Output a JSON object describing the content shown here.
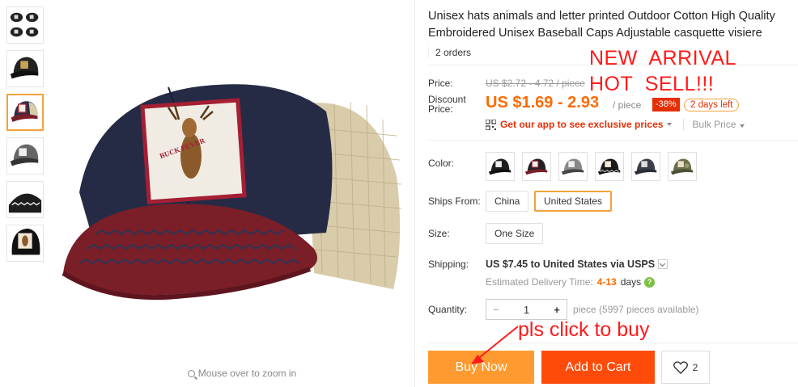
{
  "product": {
    "title": "Unisex hats animals and letter printed Outdoor Cotton High Quality Embroidered Unisex Baseball Caps Adjustable casquette visiere",
    "orders": "2 orders"
  },
  "gallery": {
    "zoom_hint": "Mouse over to zoom in",
    "patch_text": "BUCK FEVER",
    "thumbnails": [
      "thumb-1",
      "thumb-2",
      "thumb-3",
      "thumb-4",
      "thumb-5",
      "thumb-6"
    ],
    "active_index": 2
  },
  "price": {
    "label": "Price:",
    "original": "US $2.72 - 4.72 / piece",
    "discount_label_line1": "Discount",
    "discount_label_line2": "Price:",
    "current": "US $1.69 - 2.93",
    "unit": "/ piece",
    "discount_pct": "-38%",
    "days_left": "2 days left",
    "app_link": "Get our app to see exclusive prices",
    "bulk": "Bulk Price"
  },
  "promo": {
    "line1": "NEW  ARRIVAL",
    "line2": "HOT  SELL!!!",
    "cta": "pls click to buy"
  },
  "options": {
    "color_label": "Color:",
    "colors": [
      "black-white",
      "black-red",
      "grey",
      "black-pattern",
      "dark-grey",
      "camo"
    ],
    "ships_from_label": "Ships From:",
    "ships_from": [
      "China",
      "United States"
    ],
    "ships_from_selected": "United States",
    "size_label": "Size:",
    "size": "One Size"
  },
  "shipping": {
    "label": "Shipping:",
    "main": "US $7.45 to United States via USPS",
    "delivery_label": "Estimated Delivery Time:",
    "delivery_range": "4-13",
    "delivery_unit": "days"
  },
  "quantity": {
    "label": "Quantity:",
    "value": "1",
    "minus": "−",
    "plus": "+",
    "available": "piece (5997 pieces available)"
  },
  "actions": {
    "buy_now": "Buy Now",
    "add_to_cart": "Add to Cart",
    "wishlist_count": "2"
  },
  "colors": {
    "accent_orange": "#ff6a00",
    "buy_now": "#ff9a30",
    "add_to_cart": "#ff4b0a",
    "promo_red": "#ff1a1a"
  }
}
